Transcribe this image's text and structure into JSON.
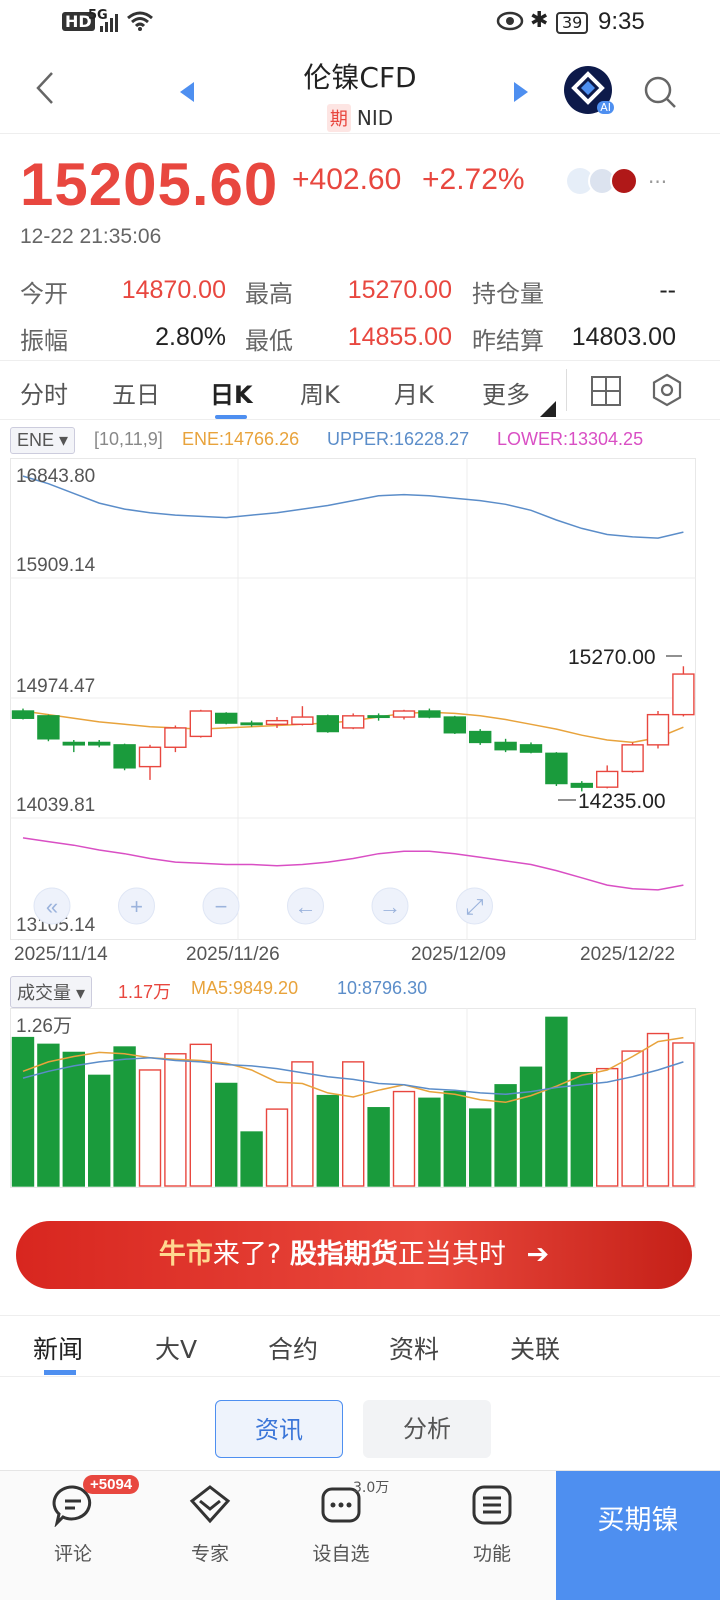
{
  "status_bar": {
    "left": "HD 5G",
    "time": "9:35",
    "battery": "39"
  },
  "header": {
    "title": "伦镍CFD",
    "qi_badge": "期",
    "code": "NID",
    "ai_badge": "AI"
  },
  "quote": {
    "price": "15205.60",
    "change": "+402.60",
    "change_pct": "+2.72%",
    "timestamp": "12-22 21:35:06",
    "more": "···"
  },
  "stats": {
    "open_label": "今开",
    "open": "14870.00",
    "high_label": "最高",
    "high": "15270.00",
    "oi_label": "持仓量",
    "oi": "--",
    "amp_label": "振幅",
    "amp": "2.80%",
    "low_label": "最低",
    "low": "14855.00",
    "settle_label": "昨结算",
    "settle": "14803.00"
  },
  "period_tabs": [
    "分时",
    "五日",
    "日K",
    "周K",
    "月K",
    "更多"
  ],
  "indicator": {
    "name": "ENE",
    "params": "[10,11,9]",
    "ene": "ENE:14766.26",
    "upper": "UPPER:16228.27",
    "lower": "LOWER:13304.25"
  },
  "price_axis": [
    "16843.80",
    "15909.14",
    "14974.47",
    "14039.81",
    "13105.14"
  ],
  "date_axis": [
    "2025/11/14",
    "2025/11/26",
    "2025/12/09",
    "2025/12/22"
  ],
  "annotations": {
    "high": "15270.00",
    "low": "14235.00"
  },
  "volume_indicator": {
    "name": "成交量",
    "vol": "1.17万",
    "ma5": "MA5:9849.20",
    "ma10": "10:8796.30",
    "axis_max": "1.26万"
  },
  "colors": {
    "up": "#e8473f",
    "down": "#1a9b3c",
    "ene": "#e8a33c",
    "upper": "#5b8dc9",
    "lower": "#d94fc4",
    "accent": "#4e8ff0"
  },
  "chart_data": {
    "type": "candlestick",
    "ylim": [
      13105.14,
      16843.8
    ],
    "candles": [
      {
        "o": 14900,
        "c": 14840,
        "h": 14920,
        "l": 14830
      },
      {
        "o": 14860,
        "c": 14670,
        "h": 14870,
        "l": 14650
      },
      {
        "o": 14640,
        "c": 14620,
        "h": 14660,
        "l": 14560
      },
      {
        "o": 14640,
        "c": 14620,
        "h": 14660,
        "l": 14600
      },
      {
        "o": 14620,
        "c": 14430,
        "h": 14630,
        "l": 14410
      },
      {
        "o": 14440,
        "c": 14600,
        "h": 14620,
        "l": 14330
      },
      {
        "o": 14600,
        "c": 14760,
        "h": 14780,
        "l": 14560
      },
      {
        "o": 14690,
        "c": 14900,
        "h": 14910,
        "l": 14680
      },
      {
        "o": 14880,
        "c": 14800,
        "h": 14890,
        "l": 14790
      },
      {
        "o": 14800,
        "c": 14790,
        "h": 14820,
        "l": 14770
      },
      {
        "o": 14790,
        "c": 14820,
        "h": 14850,
        "l": 14760
      },
      {
        "o": 14790,
        "c": 14850,
        "h": 14940,
        "l": 14780
      },
      {
        "o": 14860,
        "c": 14730,
        "h": 14870,
        "l": 14720
      },
      {
        "o": 14760,
        "c": 14860,
        "h": 14880,
        "l": 14750
      },
      {
        "o": 14860,
        "c": 14850,
        "h": 14880,
        "l": 14820
      },
      {
        "o": 14850,
        "c": 14900,
        "h": 14910,
        "l": 14830
      },
      {
        "o": 14900,
        "c": 14850,
        "h": 14920,
        "l": 14840
      },
      {
        "o": 14850,
        "c": 14720,
        "h": 14860,
        "l": 14710
      },
      {
        "o": 14730,
        "c": 14640,
        "h": 14750,
        "l": 14620
      },
      {
        "o": 14640,
        "c": 14580,
        "h": 14670,
        "l": 14560
      },
      {
        "o": 14620,
        "c": 14560,
        "h": 14640,
        "l": 14550
      },
      {
        "o": 14550,
        "c": 14300,
        "h": 14560,
        "l": 14280
      },
      {
        "o": 14300,
        "c": 14270,
        "h": 14320,
        "l": 14235
      },
      {
        "o": 14270,
        "c": 14400,
        "h": 14450,
        "l": 14260
      },
      {
        "o": 14400,
        "c": 14620,
        "h": 14640,
        "l": 14390
      },
      {
        "o": 14620,
        "c": 14870,
        "h": 14900,
        "l": 14590
      },
      {
        "o": 14870,
        "c": 15205.6,
        "h": 15270,
        "l": 14855
      }
    ],
    "ene": [
      14900,
      14870,
      14840,
      14810,
      14790,
      14770,
      14760,
      14750,
      14760,
      14770,
      14780,
      14790,
      14800,
      14820,
      14850,
      14880,
      14890,
      14880,
      14860,
      14830,
      14790,
      14750,
      14700,
      14660,
      14640,
      14680,
      14766.26
    ],
    "upper": [
      16843,
      16780,
      16700,
      16620,
      16570,
      16540,
      16520,
      16510,
      16500,
      16520,
      16540,
      16570,
      16600,
      16640,
      16680,
      16690,
      16680,
      16660,
      16640,
      16610,
      16560,
      16480,
      16410,
      16360,
      16340,
      16330,
      16380
    ],
    "lower": [
      13850,
      13820,
      13790,
      13750,
      13720,
      13680,
      13650,
      13640,
      13630,
      13630,
      13620,
      13630,
      13650,
      13680,
      13720,
      13740,
      13740,
      13720,
      13690,
      13660,
      13630,
      13580,
      13520,
      13460,
      13430,
      13420,
      13460
    ],
    "volume": [
      11000,
      10500,
      9900,
      8200,
      10300,
      8600,
      9800,
      10500,
      7600,
      4000,
      5700,
      9200,
      6700,
      9200,
      5800,
      7000,
      6500,
      7000,
      5700,
      7500,
      8800,
      12500,
      8400,
      8700,
      10000,
      11300,
      10600
    ],
    "vol_ma5": [
      8500,
      9200,
      9600,
      9900,
      9800,
      9500,
      9400,
      9300,
      9100,
      8600,
      7700,
      7600,
      6900,
      6600,
      7100,
      7500,
      7000,
      6800,
      6400,
      6200,
      6700,
      7400,
      8200,
      8600,
      9600,
      10700,
      11000
    ],
    "vol_ma10": [
      8000,
      8500,
      8900,
      9200,
      9400,
      9500,
      9300,
      9200,
      9000,
      8900,
      8700,
      8400,
      8100,
      7900,
      7600,
      7500,
      7200,
      7100,
      6900,
      6800,
      7000,
      7300,
      7500,
      7700,
      8100,
      8600,
      9200
    ],
    "vol_max": 12600
  },
  "banner": {
    "part1": "牛市",
    "part2": "来了? ",
    "part3": "股指期货",
    "part4": "正当其时",
    "arrow": "➔"
  },
  "news_tabs": [
    "新闻",
    "大V",
    "合约",
    "资料",
    "关联"
  ],
  "sub_tabs": [
    "资讯",
    "分析"
  ],
  "bottom_bar": {
    "comment": "评论",
    "comment_badge": "+5094",
    "expert": "专家",
    "watch": "设自选",
    "watch_count": "3.0万",
    "func": "功能",
    "buy": "买期镍"
  }
}
